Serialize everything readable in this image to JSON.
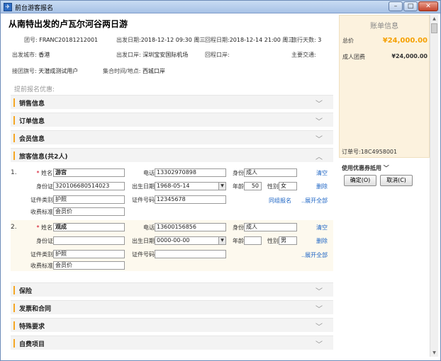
{
  "window": {
    "title": "前台游客报名",
    "min_label": "–",
    "max_label": "□",
    "close_label": "✕"
  },
  "trip": {
    "title": "从南特出发的卢瓦尔河谷两日游",
    "group_no_label": "团号:",
    "group_no": "FRANC20181212001",
    "depart_date_label": "出发日期:",
    "depart_date": "2018-12-12 09:30 周三",
    "return_date_label": "回程日期:",
    "return_date": "2018-12-14 21:00 周三",
    "days_label": "旅行天数:",
    "days": "3",
    "depart_city_label": "出发城市:",
    "depart_city": "香港",
    "depart_port_label": "出发口岸:",
    "depart_port": "深圳宝安国际机场",
    "return_port_label": "回程口岸:",
    "return_port": "",
    "transport_label": "主要交通:",
    "transport": "",
    "flag_label": "接团旗号:",
    "flag": "天潜成测试用户",
    "gather_label": "集合时间/地点:",
    "gather": "西城口岸"
  },
  "promo_label": "提前报名优惠:",
  "sections": {
    "sales": "销售信息",
    "order": "订单信息",
    "member": "会员信息",
    "travelers": "旅客信息(共2人)",
    "insurance": "保险",
    "invoice": "发票和合同",
    "special": "特殊要求",
    "self_pay": "自费项目"
  },
  "labels": {
    "name": "姓名",
    "phone": "电话",
    "identity": "身份",
    "id_card": "身份证",
    "birth": "出生日期",
    "age": "年龄",
    "gender": "性别",
    "cert_type": "证件类别",
    "cert_no": "证件号码",
    "fee_std": "收费标准",
    "clear": "清空",
    "delete": "删除",
    "same_group": "同组报名",
    "expand_all": "..展开全部"
  },
  "travelers": [
    {
      "num": "1.",
      "name": "游宫",
      "phone": "13302970898",
      "identity": "成人",
      "id_card": "320106680514023",
      "birth": "1968-05-14",
      "age": "50",
      "gender": "女",
      "cert_type": "护照",
      "cert_no": "12345678",
      "fee_std": "会员价"
    },
    {
      "num": "2.",
      "name": "观成",
      "phone": "13600156856",
      "identity": "成人",
      "id_card": "",
      "birth": "0000-00-00",
      "age": "",
      "gender": "男",
      "cert_type": "护照",
      "cert_no": "",
      "fee_std": "会员价"
    }
  ],
  "bill": {
    "title": "账单信息",
    "total_label": "总价",
    "total": "¥24,000.00",
    "adult_label": "成人团费",
    "adult": "¥24,000.00",
    "order_label": "订单号:",
    "order_no": "18C4958001",
    "coupon_label": "使用优惠券抵用",
    "confirm": "确定(O)",
    "cancel": "取消(C)"
  }
}
